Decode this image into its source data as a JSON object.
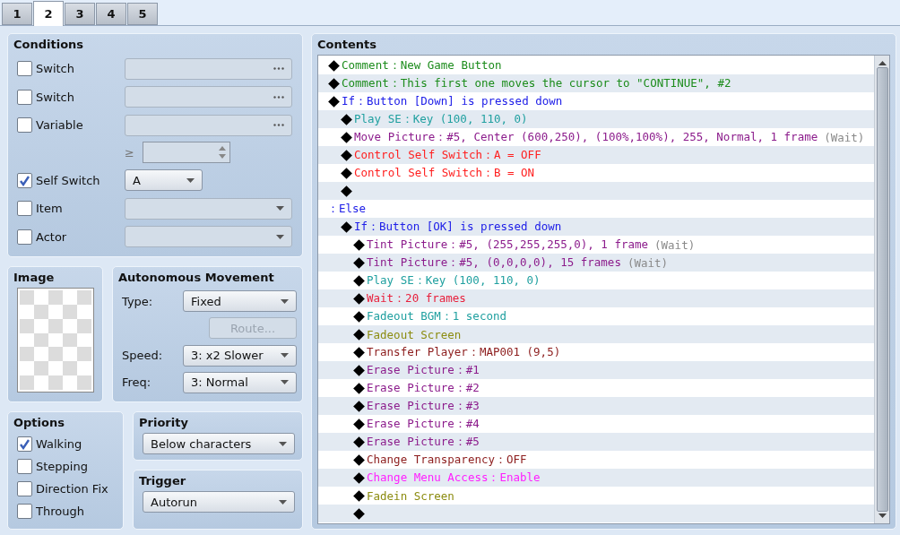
{
  "tabs": [
    {
      "label": "1",
      "selected": false
    },
    {
      "label": "2",
      "selected": true
    },
    {
      "label": "3",
      "selected": false
    },
    {
      "label": "4",
      "selected": false
    },
    {
      "label": "5",
      "selected": false
    }
  ],
  "conditions": {
    "title": "Conditions",
    "rows": [
      {
        "kind": "picker",
        "label": "Switch",
        "checked": false,
        "disabled": true
      },
      {
        "kind": "picker",
        "label": "Switch",
        "checked": false,
        "disabled": true
      },
      {
        "kind": "picker",
        "label": "Variable",
        "checked": false,
        "disabled": true
      },
      {
        "kind": "compare",
        "symbol": "≥",
        "disabled": true
      },
      {
        "kind": "select",
        "label": "Self Switch",
        "checked": true,
        "disabled": false,
        "value": "A"
      },
      {
        "kind": "dropdown",
        "label": "Item",
        "checked": false,
        "disabled": true
      },
      {
        "kind": "dropdown",
        "label": "Actor",
        "checked": false,
        "disabled": true
      }
    ]
  },
  "image": {
    "title": "Image"
  },
  "movement": {
    "title": "Autonomous Movement",
    "type_label": "Type:",
    "type": "Fixed",
    "route_button": {
      "label": "Route...",
      "disabled": true
    },
    "speed_label": "Speed:",
    "speed": "3: x2 Slower",
    "freq_label": "Freq:",
    "freq": "3: Normal"
  },
  "options": {
    "title": "Options",
    "items": [
      {
        "label": "Walking",
        "checked": true
      },
      {
        "label": "Stepping",
        "checked": false
      },
      {
        "label": "Direction Fix",
        "checked": false
      },
      {
        "label": "Through",
        "checked": false
      }
    ]
  },
  "priority": {
    "title": "Priority",
    "value": "Below characters"
  },
  "trigger": {
    "title": "Trigger",
    "value": "Autorun"
  },
  "contents": {
    "title": "Contents",
    "commands": [
      {
        "kind": "command",
        "text": "Comment：New Game Button",
        "color": "#1c8c1c"
      },
      {
        "kind": "command",
        "text": "Comment：This first one moves the cursor to \"CONTINUE\", #2",
        "color": "#1c8c1c"
      },
      {
        "kind": "command",
        "text": "If：Button [Down] is pressed down",
        "color": "#2020e8",
        "children": [
          {
            "kind": "command",
            "text": "Play SE：Key (100, 110, 0)",
            "color": "#20a0a0"
          },
          {
            "kind": "command",
            "text": "Move Picture：#5, Center (600,250), (100%,100%), 255, Normal, 1 frame",
            "color": "#8c1c8c",
            "note": "(Wait)"
          },
          {
            "kind": "command",
            "text": "Control Self Switch：A = OFF",
            "color": "#ff2020"
          },
          {
            "kind": "command",
            "text": "Control Self Switch：B = ON",
            "color": "#ff2020"
          },
          {
            "kind": "command"
          }
        ]
      },
      {
        "kind": "else",
        "text": "：Else",
        "color": "#2020e8",
        "children": [
          {
            "kind": "command",
            "text": "If：Button [OK] is pressed down",
            "color": "#2020e8",
            "children": [
              {
                "kind": "command",
                "text": "Tint Picture：#5, (255,255,255,0), 1 frame",
                "color": "#8c1c8c",
                "note": "(Wait)"
              },
              {
                "kind": "command",
                "text": "Tint Picture：#5, (0,0,0,0), 15 frames",
                "color": "#8c1c8c",
                "note": "(Wait)"
              },
              {
                "kind": "command",
                "text": "Play SE：Key (100, 110, 0)",
                "color": "#20a0a0"
              },
              {
                "kind": "command",
                "text": "Wait：20 frames",
                "color": "#e8203c"
              },
              {
                "kind": "command",
                "text": "Fadeout BGM：1 second",
                "color": "#20a0a0"
              },
              {
                "kind": "command",
                "text": "Fadeout Screen",
                "color": "#8c8c10"
              },
              {
                "kind": "command",
                "text": "Transfer Player：MAP001 (9,5)",
                "color": "#8c1c1c"
              },
              {
                "kind": "command",
                "text": "Erase Picture：#1",
                "color": "#8c1c8c"
              },
              {
                "kind": "command",
                "text": "Erase Picture：#2",
                "color": "#8c1c8c"
              },
              {
                "kind": "command",
                "text": "Erase Picture：#3",
                "color": "#8c1c8c"
              },
              {
                "kind": "command",
                "text": "Erase Picture：#4",
                "color": "#8c1c8c"
              },
              {
                "kind": "command",
                "text": "Erase Picture：#5",
                "color": "#8c1c8c"
              },
              {
                "kind": "command",
                "text": "Change Transparency：OFF",
                "color": "#8c1c1c"
              },
              {
                "kind": "command",
                "text": "Change Menu Access：Enable",
                "color": "#ff20ff"
              },
              {
                "kind": "command",
                "text": "Fadein Screen",
                "color": "#8c8c10"
              },
              {
                "kind": "command"
              }
            ]
          }
        ]
      }
    ]
  }
}
